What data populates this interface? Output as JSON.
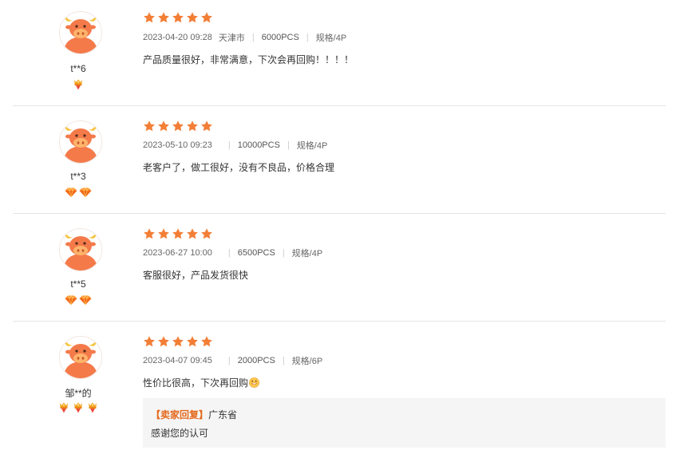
{
  "colors": {
    "star": "#f37e36",
    "divider": "#e5e5e5",
    "reply_tag": "#e4681c",
    "reply_bg": "#f5f5f5"
  },
  "reviews": [
    {
      "user": "t**6",
      "badge_icon": "crown-medal-icon",
      "badge_count": 1,
      "rating": 5,
      "datetime": "2023-04-20 09:28",
      "location": "天津市",
      "quantity": "6000PCS",
      "spec": "规格/4P",
      "comment": "产品质量很好，非常满意，下次会再回购！！！！"
    },
    {
      "user": "t**3",
      "badge_icon": "diamond-icon",
      "badge_count": 2,
      "rating": 5,
      "datetime": "2023-05-10 09:23",
      "location": "",
      "quantity": "10000PCS",
      "spec": "规格/4P",
      "comment": "老客户了，做工很好，没有不良品，价格合理"
    },
    {
      "user": "t**5",
      "badge_icon": "diamond-icon",
      "badge_count": 2,
      "rating": 5,
      "datetime": "2023-06-27 10:00",
      "location": "",
      "quantity": "6500PCS",
      "spec": "规格/4P",
      "comment": "客服很好，产品发货很快"
    },
    {
      "user": "邹**的",
      "badge_icon": "crown-medal-icon",
      "badge_count": 3,
      "rating": 5,
      "datetime": "2023-04-07 09:45",
      "location": "",
      "quantity": "2000PCS",
      "spec": "规格/6P",
      "comment": "性价比很高，下次再回购",
      "emoji": "grin-emoji-icon",
      "reply": {
        "tag": "【卖家回复】",
        "location": "广东省",
        "text": "感谢您的认可"
      }
    }
  ]
}
